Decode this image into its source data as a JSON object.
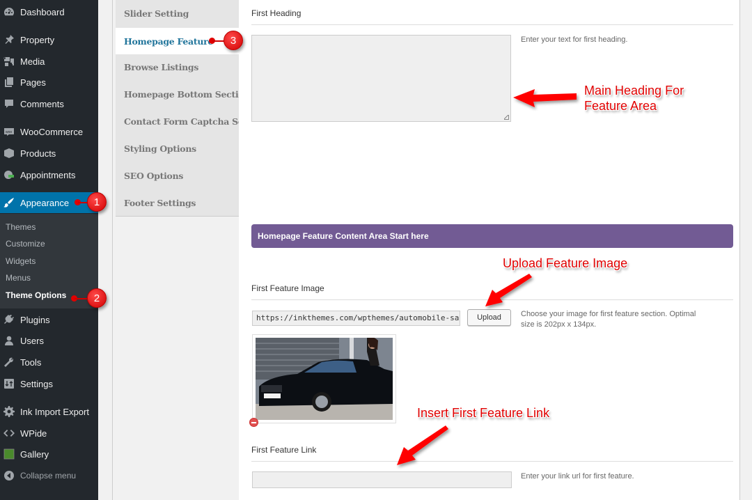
{
  "sidebar": {
    "items": [
      {
        "label": "Dashboard",
        "icon": "dashboard-icon"
      },
      {
        "label": "Property",
        "icon": "pin-icon"
      },
      {
        "label": "Media",
        "icon": "media-icon"
      },
      {
        "label": "Pages",
        "icon": "pages-icon"
      },
      {
        "label": "Comments",
        "icon": "comments-icon"
      },
      {
        "label": "WooCommerce",
        "icon": "woocommerce-icon"
      },
      {
        "label": "Products",
        "icon": "box-icon"
      },
      {
        "label": "Appointments",
        "icon": "appointments-icon"
      },
      {
        "label": "Appearance",
        "icon": "paintbrush-icon",
        "current": true
      },
      {
        "label": "Plugins",
        "icon": "plugin-icon"
      },
      {
        "label": "Users",
        "icon": "user-icon"
      },
      {
        "label": "Tools",
        "icon": "wrench-icon"
      },
      {
        "label": "Settings",
        "icon": "settings-icon"
      },
      {
        "label": "Ink Import Export",
        "icon": "gear-icon"
      },
      {
        "label": "WPide",
        "icon": "code-icon"
      },
      {
        "label": "Gallery",
        "icon": "gallery-icon"
      }
    ],
    "submenu": [
      {
        "label": "Themes"
      },
      {
        "label": "Customize"
      },
      {
        "label": "Widgets"
      },
      {
        "label": "Menus"
      },
      {
        "label": "Theme Options",
        "current": true
      }
    ],
    "collapse_label": "Collapse menu"
  },
  "option_tabs": [
    {
      "label": "Slider Setting"
    },
    {
      "label": "Homepage Feature",
      "active": true
    },
    {
      "label": "Browse Listings"
    },
    {
      "label": "Homepage Bottom Section"
    },
    {
      "label": "Contact Form Captcha Section"
    },
    {
      "label": "Styling Options"
    },
    {
      "label": "SEO Options"
    },
    {
      "label": "Footer Settings"
    }
  ],
  "content": {
    "first_heading": {
      "title": "First Heading",
      "value": "",
      "description": "Enter your text for first heading."
    },
    "section_banner": "Homepage Feature Content Area Start here",
    "first_feature_image": {
      "title": "First Feature Image",
      "url_value": "https://inkthemes.com/wpthemes/automobile-sales-w",
      "upload_label": "Upload",
      "description": "Choose your image for first feature section. Optimal size is 202px x 134px.",
      "preview_alt": "Black luxury sedan with woman at open door"
    },
    "first_feature_link": {
      "title": "First Feature Link",
      "value": "",
      "description": "Enter your link url for first feature."
    }
  },
  "annotations": {
    "badges": [
      "1",
      "2",
      "3"
    ],
    "main_heading_note_line1": "Main Heading For",
    "main_heading_note_line2": "Feature Area",
    "upload_note": "Upload Feature Image",
    "link_note": "Insert First Feature Link",
    "color": "#e00000"
  },
  "colors": {
    "sidebar_bg": "#23282d",
    "submenu_bg": "#32373c",
    "current_menu_bg": "#0073aa",
    "active_tab_text": "#21759b",
    "banner_bg": "#725b94"
  }
}
